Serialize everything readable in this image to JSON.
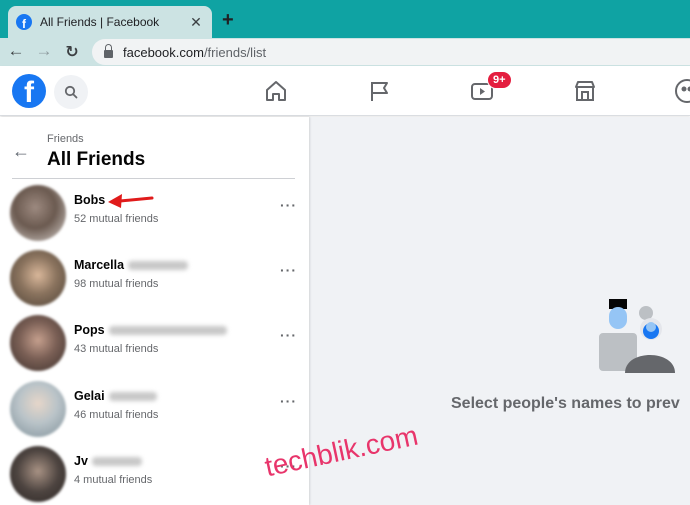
{
  "browser": {
    "tab_title": "All Friends | Facebook",
    "tab_close": "✕",
    "new_tab": "+",
    "back": "←",
    "forward": "→",
    "reload": "↻",
    "url_host": "facebook.com",
    "url_path": "/friends/list"
  },
  "header": {
    "logo_letter": "f",
    "notification_badge": "9+",
    "icons": [
      "home-icon",
      "pages-flag-icon",
      "watch-video-icon",
      "marketplace-icon",
      "groups-icon"
    ]
  },
  "sidebar": {
    "back": "←",
    "breadcrumb": "Friends",
    "title": "All Friends",
    "friends": [
      {
        "name": "Bobs",
        "mutual": "52 mutual friends",
        "avatar_color": "#6b5a50"
      },
      {
        "name": "Marcella",
        "mutual": "98 mutual friends",
        "avatar_color": "#7a6a58"
      },
      {
        "name": "Pops",
        "mutual": "43 mutual friends",
        "avatar_color": "#5e4e48"
      },
      {
        "name": "Gelai",
        "mutual": "46 mutual friends",
        "avatar_color": "#b9c3c8"
      },
      {
        "name": "Jv",
        "mutual": "4 mutual friends",
        "avatar_color": "#4d4440"
      }
    ],
    "more_label": "···"
  },
  "main": {
    "empty_message": "Select people's names to prev"
  },
  "watermark": "techblik.com",
  "colors": {
    "facebook_blue": "#1877f2",
    "badge_red": "#e41e3f",
    "browser_tabstrip": "#0fa3a3",
    "watermark": "#e8356b"
  }
}
